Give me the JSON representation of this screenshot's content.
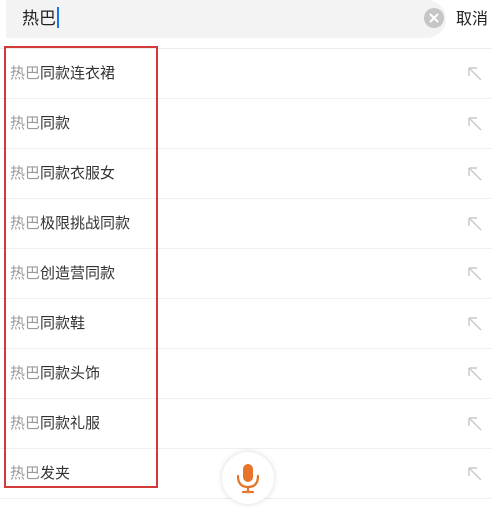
{
  "search": {
    "value": "热巴",
    "cancel_label": "取消"
  },
  "suggestions": [
    {
      "highlight": "热巴",
      "rest": "同款连衣裙"
    },
    {
      "highlight": "热巴",
      "rest": "同款"
    },
    {
      "highlight": "热巴",
      "rest": "同款衣服女"
    },
    {
      "highlight": "热巴",
      "rest": "极限挑战同款"
    },
    {
      "highlight": "热巴",
      "rest": "创造营同款"
    },
    {
      "highlight": "热巴",
      "rest": "同款鞋"
    },
    {
      "highlight": "热巴",
      "rest": "同款头饰"
    },
    {
      "highlight": "热巴",
      "rest": "同款礼服"
    },
    {
      "highlight": "热巴",
      "rest": "发夹"
    }
  ],
  "icons": {
    "clear": "clear-circle-icon",
    "fill_query": "arrow-up-left-icon",
    "voice": "microphone-icon"
  },
  "colors": {
    "accent": "#e8732a",
    "highlight_box": "#d33a3a",
    "matched_text": "#9a9a9a"
  }
}
